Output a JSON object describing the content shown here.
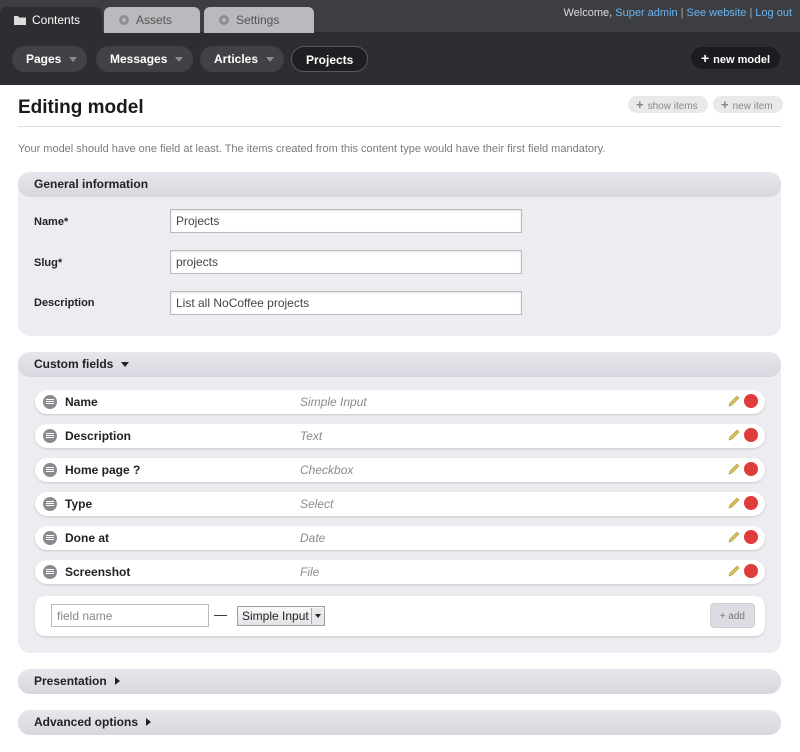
{
  "top_tabs": [
    {
      "label": "Contents",
      "icon": "folder-icon"
    },
    {
      "label": "Assets",
      "icon": "gear-icon"
    },
    {
      "label": "Settings",
      "icon": "gear-icon"
    }
  ],
  "welcome": {
    "prefix": "Welcome,",
    "user": "Super admin",
    "see_website": "See website",
    "logout": "Log out",
    "separator": "|"
  },
  "subnav": {
    "items": [
      "Pages",
      "Messages",
      "Articles",
      "Projects"
    ],
    "active": "Projects",
    "new_model": "new model"
  },
  "page": {
    "title": "Editing model",
    "show_items": "show items",
    "new_item": "new item",
    "intro": "Your model should have one field at least. The items created from this content type would have their first field mandatory."
  },
  "general": {
    "heading": "General information",
    "name_label": "Name*",
    "name_value": "Projects",
    "slug_label": "Slug*",
    "slug_value": "projects",
    "description_label": "Description",
    "description_value": "List all NoCoffee projects"
  },
  "custom_fields": {
    "heading": "Custom fields",
    "fields": [
      {
        "name": "Name",
        "type": "Simple Input"
      },
      {
        "name": "Description",
        "type": "Text"
      },
      {
        "name": "Home page ?",
        "type": "Checkbox"
      },
      {
        "name": "Type",
        "type": "Select"
      },
      {
        "name": "Done at",
        "type": "Date"
      },
      {
        "name": "Screenshot",
        "type": "File"
      }
    ],
    "new_field_placeholder": "field name",
    "dash": "—",
    "new_field_type": "Simple Input",
    "add_label": "+ add"
  },
  "presentation": {
    "heading": "Presentation"
  },
  "advanced": {
    "heading": "Advanced options"
  },
  "colors": {
    "topbar": "#3d3e42",
    "subnav": "#2d2e32",
    "link": "#6ab4f0",
    "delete": "#e03c3c",
    "edit": "#d7c25a"
  }
}
